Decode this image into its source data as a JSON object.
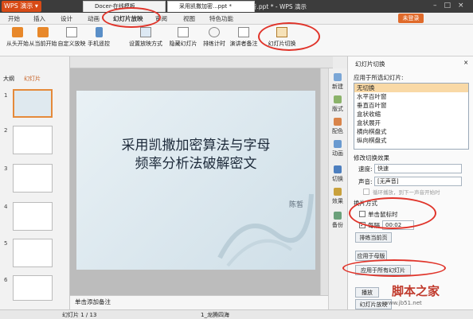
{
  "app": {
    "logo": "WPS 演示",
    "title": "采用凯撒加密算法与字母频率分析.ppt * - WPS 演示",
    "login": "未登录"
  },
  "menu": [
    "开始",
    "插入",
    "设计",
    "动画",
    "幻灯片放映",
    "审阅",
    "视图",
    "特色功能"
  ],
  "ribbon": [
    "从头开始",
    "从当前开始",
    "自定义放映",
    "手机遥控",
    "设置放映方式",
    "隐藏幻灯片",
    "排练计时",
    "演讲者备注",
    "幻灯片切换"
  ],
  "doc_tabs": [
    "Docer-在线模板",
    "采用凯撒加密...ppt *"
  ],
  "left_panel": {
    "tabs": [
      "大纲",
      "幻灯片"
    ],
    "thumb_numbers": [
      "1",
      "2",
      "3",
      "4",
      "5",
      "6"
    ]
  },
  "slide": {
    "title_line1": "采用凯撒加密算法与字母",
    "title_line2": "频率分析法破解密文",
    "author": "陈皙"
  },
  "notes_placeholder": "单击添加备注",
  "sidebar": [
    "新建",
    "版式",
    "配色",
    "动画",
    "切换",
    "效果",
    "备份"
  ],
  "pane": {
    "title": "幻灯片切换",
    "apply_selected": "应用于所选幻灯片:",
    "effects": [
      "无切换",
      "水平百叶窗",
      "垂直百叶窗",
      "盒状收缩",
      "盒状展开",
      "横向棋盘式",
      "纵向棋盘式"
    ],
    "modify": "修改切换效果",
    "speed_label": "速度:",
    "speed_value": "快速",
    "sound_label": "声音:",
    "sound_value": "[无声音]",
    "loop_label": "循环播放，到下一声音开始时",
    "advance": "换片方式",
    "on_click": "单击鼠标时",
    "every": "每隔",
    "every_value": "00:02",
    "rehearse": "排练当前页",
    "apply_master": "应用于母版",
    "apply_all": "应用于所有幻灯片",
    "play": "播放",
    "show": "幻灯片放映"
  },
  "status": {
    "slide_info": "幻灯片 1 / 13",
    "theme": "1_龙腾四海"
  },
  "watermark": {
    "text": "脚本之家",
    "url": "www.jb51.net"
  }
}
